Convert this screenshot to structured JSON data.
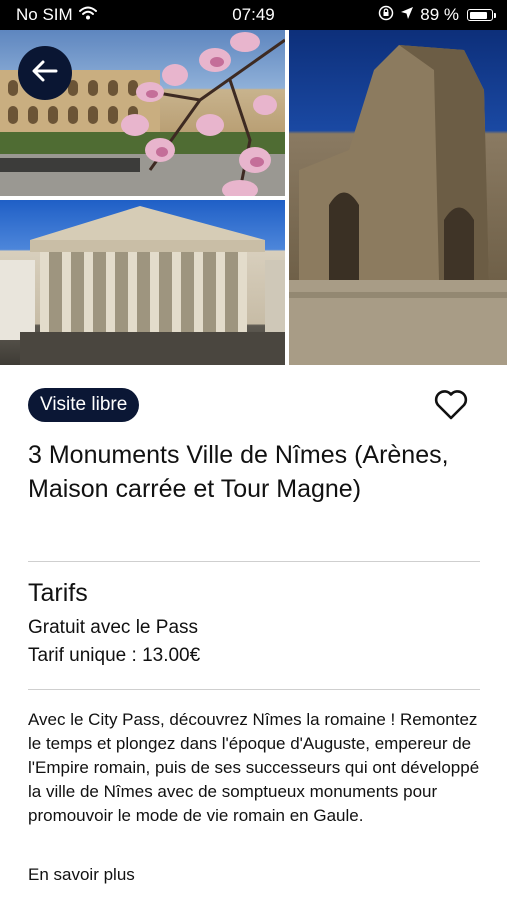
{
  "status_bar": {
    "carrier": "No SIM",
    "time": "07:49",
    "battery_percent": "89 %",
    "battery_level": 0.89,
    "icons": [
      "wifi-icon",
      "rotation-lock-icon",
      "location-icon",
      "battery-icon"
    ]
  },
  "hero": {
    "photos": [
      "arenes-photo",
      "maison-carree-photo",
      "tour-magne-photo"
    ],
    "back_icon": "arrow-left-icon"
  },
  "detail": {
    "badge": "Visite libre",
    "favorite_icon": "heart-outline-icon",
    "title": "3 Monuments Ville de Nîmes (Arènes, Maison carrée et Tour Magne)",
    "tarifs_heading": "Tarifs",
    "tarifs": [
      "Gratuit avec le Pass",
      "Tarif unique : 13.00€"
    ],
    "description": "Avec le City Pass, découvrez Nîmes la romaine ! Remontez le temps et plongez dans l'époque d'Auguste, empereur de l'Empire romain, puis de ses successeurs qui ont développé la ville de Nîmes avec de somptueux monuments pour promouvoir le mode de vie romain en Gaule.",
    "more_link": "En savoir plus"
  },
  "colors": {
    "badge_bg": "#0b1735",
    "back_button_bg": "#0a1633",
    "divider": "#cfcfcf",
    "status_bar_bg": "#000000"
  }
}
